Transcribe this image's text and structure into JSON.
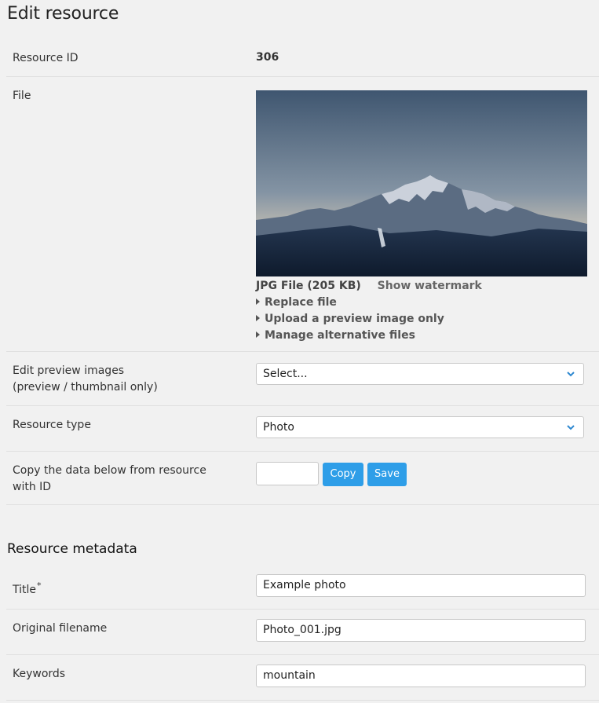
{
  "page": {
    "title": "Edit resource"
  },
  "resource_id": {
    "label": "Resource ID",
    "value": "306"
  },
  "file": {
    "label": "File",
    "image_alt": "mountain-landscape-preview",
    "format_size": "JPG File (205 KB)",
    "show_watermark": "Show watermark",
    "actions": [
      "Replace file",
      "Upload a preview image only",
      "Manage alternative files"
    ]
  },
  "preview_images": {
    "label_line1": "Edit preview images",
    "label_line2": "(preview / thumbnail only)",
    "selected": "Select..."
  },
  "resource_type": {
    "label": "Resource type",
    "selected": "Photo"
  },
  "copy_data": {
    "label_line1": "Copy the data below from resource",
    "label_line2": "with ID",
    "input_value": "",
    "copy_label": "Copy",
    "save_label": "Save"
  },
  "metadata": {
    "section_title": "Resource metadata",
    "title": {
      "label": "Title",
      "required_mark": "*",
      "value": "Example photo"
    },
    "original_filename": {
      "label": "Original filename",
      "value": "Photo_001.jpg"
    },
    "keywords": {
      "label": "Keywords",
      "value": "mountain"
    }
  },
  "colors": {
    "accent": "#2e9ee8",
    "background": "#f1f1f1"
  }
}
